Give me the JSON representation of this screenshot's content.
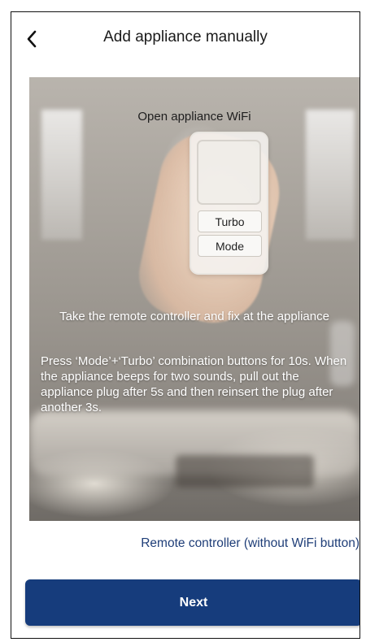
{
  "header": {
    "title": "Add appliance manually",
    "back_icon": "chevron-left-icon"
  },
  "hero": {
    "title": "Open appliance WiFi",
    "remote_buttons": {
      "turbo": "Turbo",
      "mode": "Mode"
    },
    "caption": "Take the remote controller and fix at the appliance",
    "instructions": "Press ‘Mode’+‘Turbo’ combination buttons for 10s. When the appliance beeps for two sounds, pull out the appliance plug after 5s and then reinsert the plug after another 3s."
  },
  "link": {
    "label": "Remote controller (without WiFi button)"
  },
  "footer": {
    "next_label": "Next"
  },
  "colors": {
    "primary": "#163c7c",
    "link": "#1f3e78"
  }
}
